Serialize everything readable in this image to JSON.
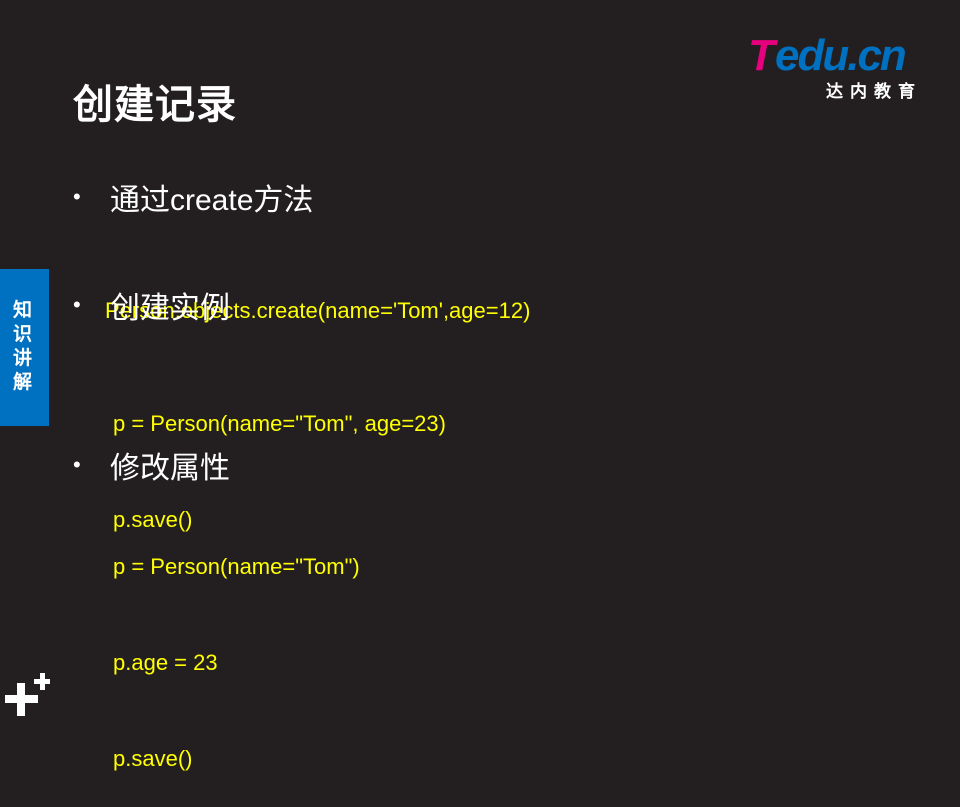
{
  "slide": {
    "title": "创建记录",
    "side_tab": "知识讲解"
  },
  "logo": {
    "brand": "Tedu.cn",
    "subtitle": "达内教育",
    "colors": {
      "T": "#e6007e",
      "rest": "#0070c0",
      "subtitle": "#ffffff"
    }
  },
  "bullets": [
    {
      "text": "通过create方法",
      "code": [
        "Person.objects.create(name='Tom',age=12)"
      ]
    },
    {
      "text": "创建实例",
      "code": [
        "p = Person(name=\"Tom\", age=23)",
        "p.save()"
      ]
    },
    {
      "text": "修改属性",
      "code": [
        "p = Person(name=\"Tom\")",
        "p.age = 23",
        "p.save()"
      ]
    }
  ],
  "colors": {
    "background": "#231f20",
    "code": "#ffff00",
    "side_tab": "#0070c0"
  },
  "icons": {
    "corner": "plus-plus-icon"
  }
}
